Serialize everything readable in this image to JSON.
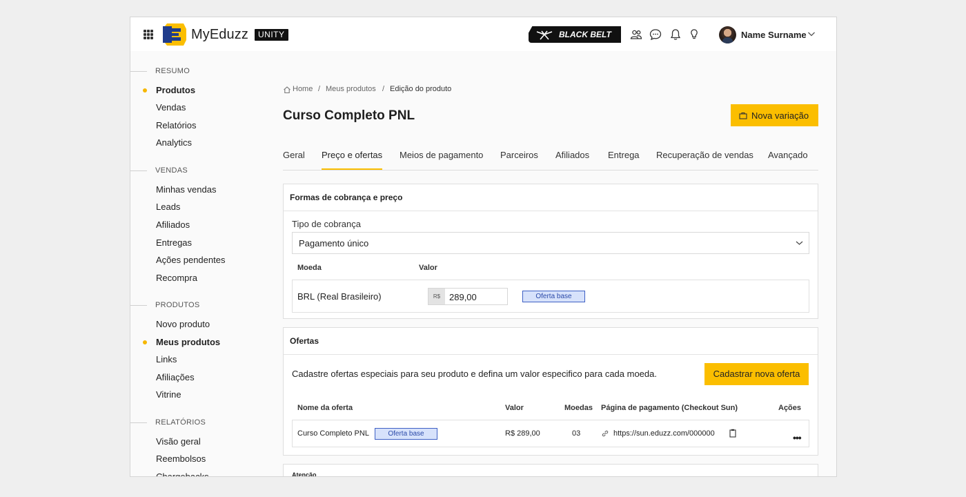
{
  "topbar": {
    "brand": "MyEduzz",
    "badge": "UNITY",
    "black_belt": "BLACK BELT",
    "user_name": "Name Surname",
    "icons": [
      "apps-grid-icon",
      "users-icon",
      "chat-icon",
      "bell-icon",
      "lightbulb-icon",
      "chevron-down-icon"
    ]
  },
  "sidebar": {
    "sections": [
      {
        "title": "RESUMO",
        "items": [
          "Produtos",
          "Vendas",
          "Relatórios",
          "Analytics"
        ]
      },
      {
        "title": "VENDAS",
        "items": [
          "Minhas vendas",
          "Leads",
          "Afiliados",
          "Entregas",
          "Ações pendentes",
          "Recompra"
        ]
      },
      {
        "title": "PRODUTOS",
        "items": [
          "Novo produto",
          "Meus produtos",
          "Links",
          "Afiliações",
          "Vitrine"
        ]
      },
      {
        "title": "RELATÓRIOS",
        "items": [
          "Visão geral",
          "Reembolsos",
          "Chargebacks"
        ]
      }
    ],
    "active_items": [
      "Produtos",
      "Meus produtos"
    ]
  },
  "breadcrumb": {
    "home": "Home",
    "sep1": "/",
    "products": "Meus produtos",
    "sep2": "/",
    "current": "Edição do produto"
  },
  "page": {
    "title": "Curso Completo PNL",
    "new_variation": "Nova variação"
  },
  "tabs": [
    "Geral",
    "Preço e ofertas",
    "Meios de pagamento",
    "Parceiros",
    "Afiliados",
    "Entrega",
    "Recuperação de vendas",
    "Avançado"
  ],
  "active_tab": "Preço e ofertas",
  "pricing": {
    "header": "Formas de cobrança e preço",
    "billing_type_label": "Tipo de cobrança",
    "billing_type_value": "Pagamento único",
    "col_currency": "Moeda",
    "col_value": "Valor",
    "currency": "BRL (Real Brasileiro)",
    "currency_prefix": "R$",
    "price": "289,00",
    "base_badge": "Oferta base"
  },
  "offers": {
    "header": "Ofertas",
    "description": "Cadastre ofertas especiais para seu produto e defina um valor especifico para cada moeda.",
    "new_offer": "Cadastrar nova oferta",
    "columns": [
      "Nome da oferta",
      "Valor",
      "Moedas",
      "Página de pagamento (Checkout Sun)",
      "Ações"
    ],
    "rows": [
      {
        "name": "Curso Completo PNL",
        "badge": "Oferta base",
        "value": "R$ 289,00",
        "currencies": "03",
        "url": "https://sun.eduzz.com/000000",
        "actions": "•••"
      }
    ]
  },
  "attention": {
    "title": "Atenção"
  },
  "colors": {
    "accent": "#fbbe00",
    "badge_bg": "#d7e2fb",
    "badge_border": "#3d5fc4"
  }
}
